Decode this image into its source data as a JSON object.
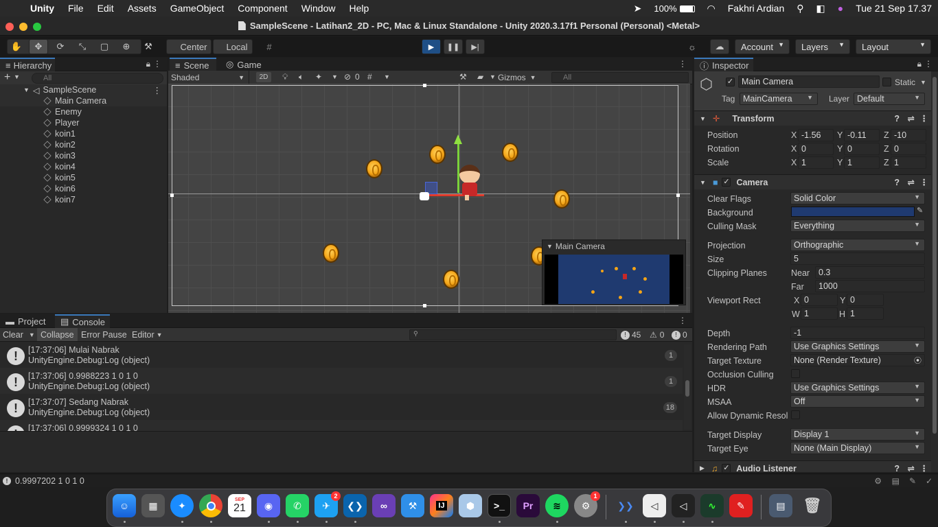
{
  "menubar": {
    "app": "Unity",
    "items": [
      "File",
      "Edit",
      "Assets",
      "GameObject",
      "Component",
      "Window",
      "Help"
    ],
    "battery": "100%",
    "user": "Fakhri Ardian",
    "datetime": "Tue 21 Sep  17.37"
  },
  "window": {
    "title": "SampleScene - Latihan2_2D - PC, Mac & Linux Standalone - Unity 2020.3.17f1 Personal (Personal) <Metal>"
  },
  "toolbar": {
    "pivot": "Center",
    "space": "Local",
    "account": "Account",
    "layers": "Layers",
    "layout": "Layout"
  },
  "hierarchy": {
    "tab": "Hierarchy",
    "search_placeholder": "All",
    "scene": "SampleScene",
    "items": [
      "Main Camera",
      "Enemy",
      "Player",
      "koin1",
      "koin2",
      "koin3",
      "koin4",
      "koin5",
      "koin6",
      "koin7"
    ]
  },
  "scene_view": {
    "tabs": [
      "Scene",
      "Game"
    ],
    "shading": "Shaded",
    "mode_2d": "2D",
    "hidden_count": "0",
    "gizmos": "Gizmos",
    "search_placeholder": "All",
    "camera_preview_title": "Main Camera"
  },
  "inspector": {
    "tab": "Inspector",
    "object_name": "Main Camera",
    "static_label": "Static",
    "tag_label": "Tag",
    "tag": "MainCamera",
    "layer_label": "Layer",
    "layer": "Default",
    "transform": {
      "title": "Transform",
      "position_label": "Position",
      "position": {
        "x": "-1.56",
        "y": "-0.11",
        "z": "-10"
      },
      "rotation_label": "Rotation",
      "rotation": {
        "x": "0",
        "y": "0",
        "z": "0"
      },
      "scale_label": "Scale",
      "scale": {
        "x": "1",
        "y": "1",
        "z": "1"
      }
    },
    "camera": {
      "title": "Camera",
      "clear_flags_label": "Clear Flags",
      "clear_flags": "Solid Color",
      "background_label": "Background",
      "background_color": "#1f3a70",
      "culling_mask_label": "Culling Mask",
      "culling_mask": "Everything",
      "projection_label": "Projection",
      "projection": "Orthographic",
      "size_label": "Size",
      "size": "5",
      "clipping_label": "Clipping Planes",
      "near_label": "Near",
      "near": "0.3",
      "far_label": "Far",
      "far": "1000",
      "viewport_label": "Viewport Rect",
      "vx": "0",
      "vy": "0",
      "vw": "1",
      "vh": "1",
      "depth_label": "Depth",
      "depth": "-1",
      "rendering_path_label": "Rendering Path",
      "rendering_path": "Use Graphics Settings",
      "target_texture_label": "Target Texture",
      "target_texture": "None (Render Texture)",
      "occlusion_label": "Occlusion Culling",
      "hdr_label": "HDR",
      "hdr": "Use Graphics Settings",
      "msaa_label": "MSAA",
      "msaa": "Off",
      "dynamic_res_label": "Allow Dynamic Resol",
      "target_display_label": "Target Display",
      "target_display": "Display 1",
      "target_eye_label": "Target Eye",
      "target_eye": "None (Main Display)"
    },
    "audio_listener": "Audio Listener"
  },
  "console": {
    "tabs": [
      "Project",
      "Console"
    ],
    "clear": "Clear",
    "collapse": "Collapse",
    "error_pause": "Error Pause",
    "editor": "Editor",
    "log_count": "45",
    "warn_count": "0",
    "error_count": "0",
    "entries": [
      {
        "line1": "[17:37:06] Mulai Nabrak",
        "line2": "UnityEngine.Debug:Log (object)",
        "count": "1"
      },
      {
        "line1": "[17:37:06] 0.9988223 1 0 1 0",
        "line2": "UnityEngine.Debug:Log (object)",
        "count": "1"
      },
      {
        "line1": "[17:37:07] Sedang Nabrak",
        "line2": "UnityEngine.Debug:Log (object)",
        "count": "18"
      },
      {
        "line1": "[17:37:06] 0.9999324 1 0 1 0",
        "line2": "",
        "count": ""
      }
    ]
  },
  "statusbar": {
    "message": "0.9997202 1 0 1 0"
  },
  "dock": {
    "calendar_month": "SEP",
    "calendar_day": "21",
    "twitter_badge": "2",
    "settings_badge": "1"
  },
  "colors": {
    "accent": "#3a79bb",
    "play_active": "#1f4f86",
    "scene_bg": "#444444"
  }
}
